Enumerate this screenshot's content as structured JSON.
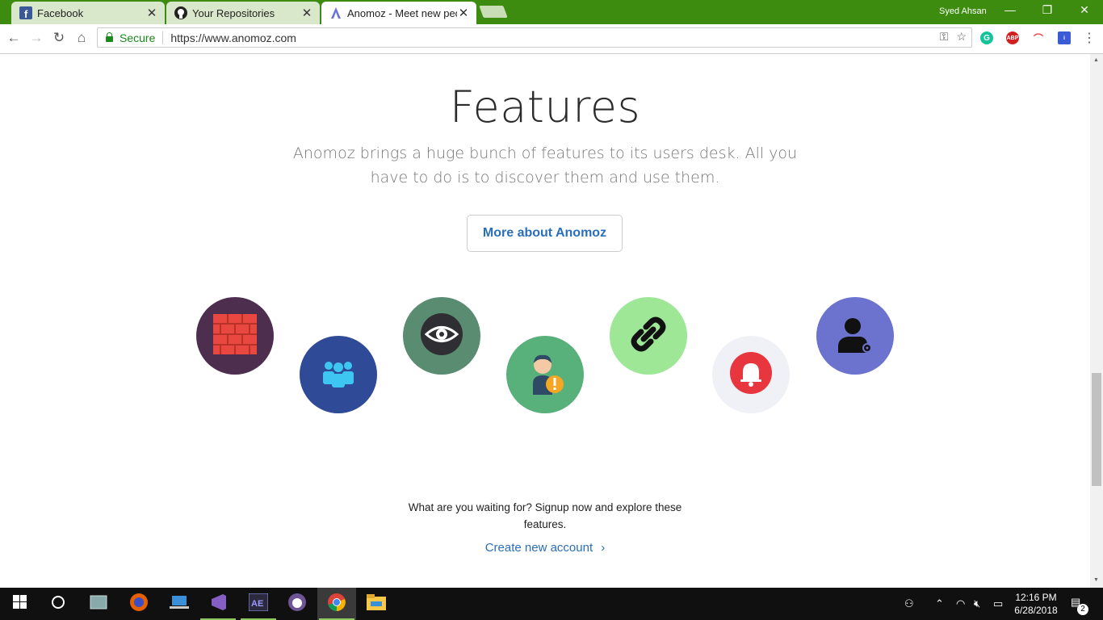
{
  "browser": {
    "tabs": [
      {
        "title": "Facebook",
        "icon": "facebook-icon"
      },
      {
        "title": "Your Repositories",
        "icon": "github-icon"
      },
      {
        "title": "Anomoz - Meet new peo",
        "icon": "anomoz-icon"
      }
    ],
    "profile": "Syed Ahsan",
    "secure_label": "Secure",
    "url": "https://www.anomoz.com"
  },
  "page": {
    "heading": "Features",
    "subtitle": "Anomoz brings a huge bunch of features to its users desk. All you have to do is to discover them and use them.",
    "more_button": "More about Anomoz",
    "cta_text": "What are you waiting for? Signup now and explore these features.",
    "create_link": "Create new account",
    "features": [
      {
        "icon": "firewall-icon",
        "color": "#4e2e4f"
      },
      {
        "icon": "group-icon",
        "color": "#2f4a96"
      },
      {
        "icon": "eye-icon",
        "color": "#5a8c72"
      },
      {
        "icon": "user-alert-icon",
        "color": "#58b07a"
      },
      {
        "icon": "link-icon",
        "color": "#9de797"
      },
      {
        "icon": "bell-icon",
        "color": "#f0f1f6"
      },
      {
        "icon": "user-settings-icon",
        "color": "#6c73cf"
      }
    ]
  },
  "taskbar": {
    "time": "12:16 PM",
    "date": "6/28/2018",
    "notifications": "2"
  },
  "colors": {
    "tab_strip": "#3d8b0f",
    "link": "#2b6fb6",
    "secure": "#1a8a1a"
  }
}
